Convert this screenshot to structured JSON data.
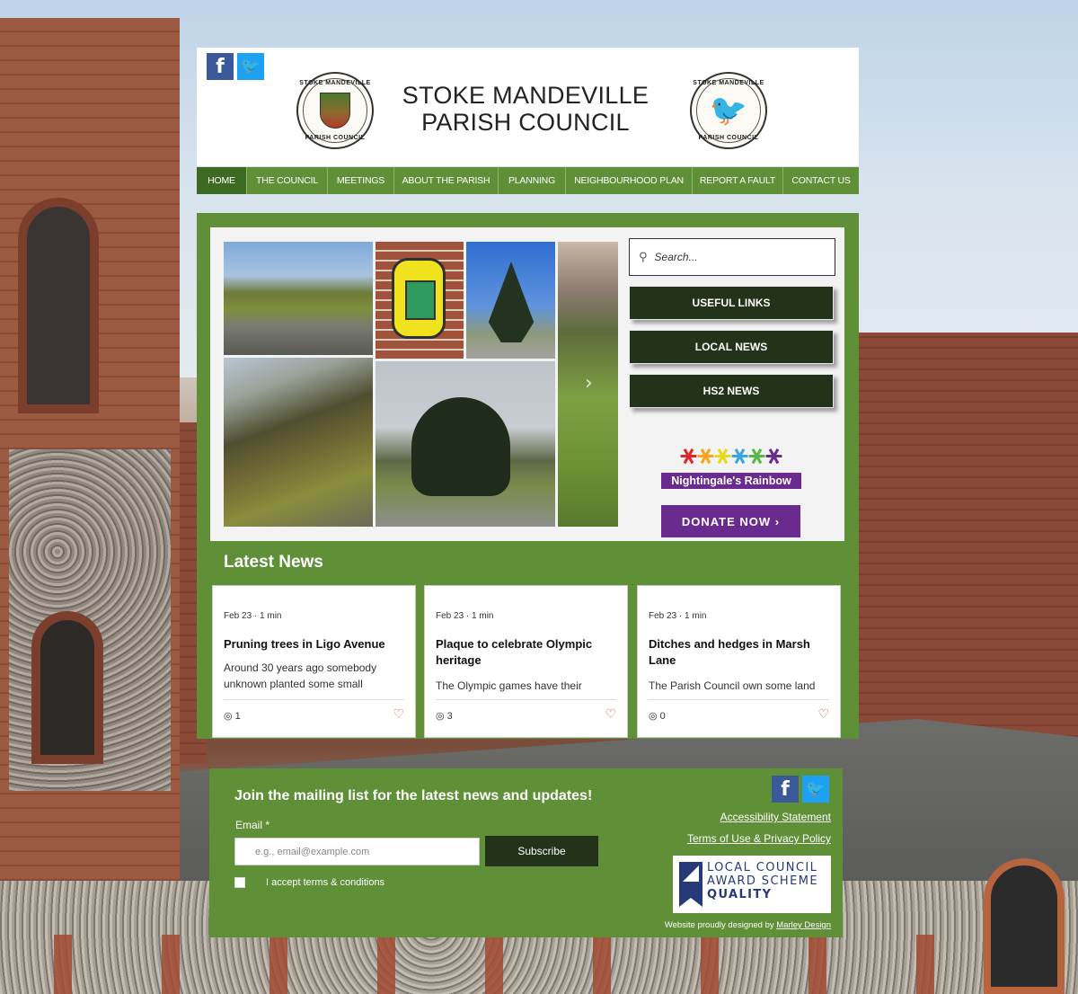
{
  "site": {
    "title_line1": "STOKE MANDEVILLE",
    "title_line2": "PARISH COUNCIL",
    "crest_left_top": "STOKE MANDEVILLE",
    "crest_left_bottom": "PARISH COUNCIL",
    "crest_right_top": "STOKE MANDEVILLE",
    "crest_right_bottom": "PARISH COUNCIL"
  },
  "social": {
    "facebook_icon": "f",
    "twitter_icon": "🐦"
  },
  "nav": {
    "items": [
      {
        "label": "HOME",
        "active": true
      },
      {
        "label": "THE COUNCIL"
      },
      {
        "label": "MEETINGS"
      },
      {
        "label": "ABOUT THE PARISH"
      },
      {
        "label": "PLANNING"
      },
      {
        "label": "NEIGHBOURHOOD PLAN"
      },
      {
        "label": "REPORT A FAULT"
      },
      {
        "label": "CONTACT US"
      }
    ]
  },
  "search": {
    "placeholder": "Search..."
  },
  "side_buttons": {
    "useful_links": "USEFUL LINKS",
    "local_news": "LOCAL NEWS",
    "hs2_news": "HS2 NEWS"
  },
  "rainbow": {
    "label": "Nightingale's Rainbow",
    "donate": "DONATE NOW ›",
    "colors": [
      "#e2242b",
      "#f7a51c",
      "#e8d81e",
      "#3aa6dd",
      "#56b848",
      "#6a2b8f"
    ]
  },
  "news": {
    "heading": "Latest News",
    "posts": [
      {
        "date": "Feb 23",
        "read": "1 min",
        "title": "Pruning trees in Ligo Avenue",
        "excerpt": "Around 30 years ago somebody unknown planted some small",
        "views": "1"
      },
      {
        "date": "Feb 23",
        "read": "1 min",
        "title": "Plaque to celebrate Olympic heritage",
        "excerpt": "The Olympic games have their",
        "views": "3"
      },
      {
        "date": "Feb 23",
        "read": "1 min",
        "title": "Ditches and hedges in Marsh Lane",
        "excerpt": "The Parish Council own some land",
        "views": "0"
      }
    ]
  },
  "footer": {
    "mailing_title": "Join the mailing list for the latest news and updates!",
    "email_label": "Email *",
    "email_placeholder": "e.g., email@example.com",
    "subscribe": "Subscribe",
    "accept": "I accept terms & conditions",
    "accessibility": "Accessibility Statement",
    "terms": "Terms of Use & Privacy Policy",
    "award_line1": "LOCAL COUNCIL",
    "award_line2": "AWARD SCHEME",
    "award_line3": "QUALITY",
    "credit_text": "Website proudly designed by",
    "credit_link": "Marley Design"
  },
  "colors": {
    "brand_green": "#5f8f37",
    "dark_green": "#22331a",
    "purple": "#6a2b8f"
  }
}
